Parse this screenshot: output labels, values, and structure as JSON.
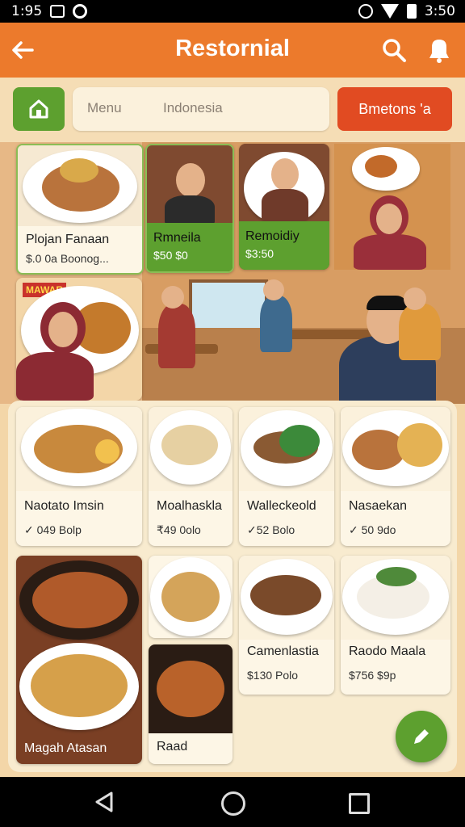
{
  "status_bar": {
    "time": "1:95",
    "clock": "3:50"
  },
  "app_bar": {
    "title": "Restornial"
  },
  "toolbar": {
    "search_seg1": "Menu",
    "search_seg2": "Indonesia",
    "promo_label": "Bmetons 'a"
  },
  "hero": {
    "card1": {
      "name": "Plojan Fanaan",
      "price": "$.0 0a Boonog..."
    },
    "card2": {
      "name": "Rmneila",
      "price": "$50 $0"
    },
    "card3": {
      "name": "Remoidiy",
      "price": "$3:50"
    },
    "card4": {
      "banner": "MAWAR"
    }
  },
  "menu": {
    "items": [
      {
        "name": "Naotato Imsin",
        "price": "✓ 049 Bolp"
      },
      {
        "name": "Moalhaskla",
        "price": "₹49 0olo"
      },
      {
        "name": "Walleckeold",
        "price": "✓52 Bolo"
      },
      {
        "name": "Nasaekan",
        "price": "✓ 50 9do"
      },
      {
        "name": "Camenlastia",
        "price": "$130 Polo"
      },
      {
        "name": "Raodo Maala",
        "price": "$756 $9p"
      },
      {
        "name": "Magah Atasan",
        "price": ""
      },
      {
        "name": "Raad",
        "price": ""
      }
    ]
  },
  "colors": {
    "primary": "#ec7a2c",
    "green": "#5da02f",
    "red": "#e14b22"
  }
}
